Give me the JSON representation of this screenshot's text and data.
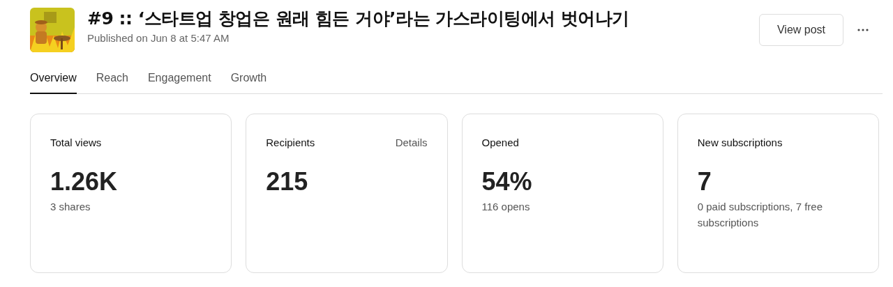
{
  "header": {
    "title": "#9 :: ‘스타트업 창업은 원래 힘든 거야’라는 가스라이팅에서 벗어나기",
    "published": "Published on Jun 8 at 5:47 AM",
    "button": "View post"
  },
  "tabs": [
    {
      "label": "Overview",
      "selected": true
    },
    {
      "label": "Reach",
      "selected": false
    },
    {
      "label": "Engagement",
      "selected": false
    },
    {
      "label": "Growth",
      "selected": false
    }
  ],
  "cards": [
    {
      "title": "Total views",
      "value": "1.26K",
      "detail": "3 shares"
    },
    {
      "title": "Recipients",
      "link": "Details",
      "value": "215"
    },
    {
      "title": "Opened",
      "value": "54%",
      "detail": "116 opens"
    },
    {
      "title": "New subscriptions",
      "value": "7",
      "detail": "0 paid subscriptions, 7 free subscriptions"
    }
  ]
}
